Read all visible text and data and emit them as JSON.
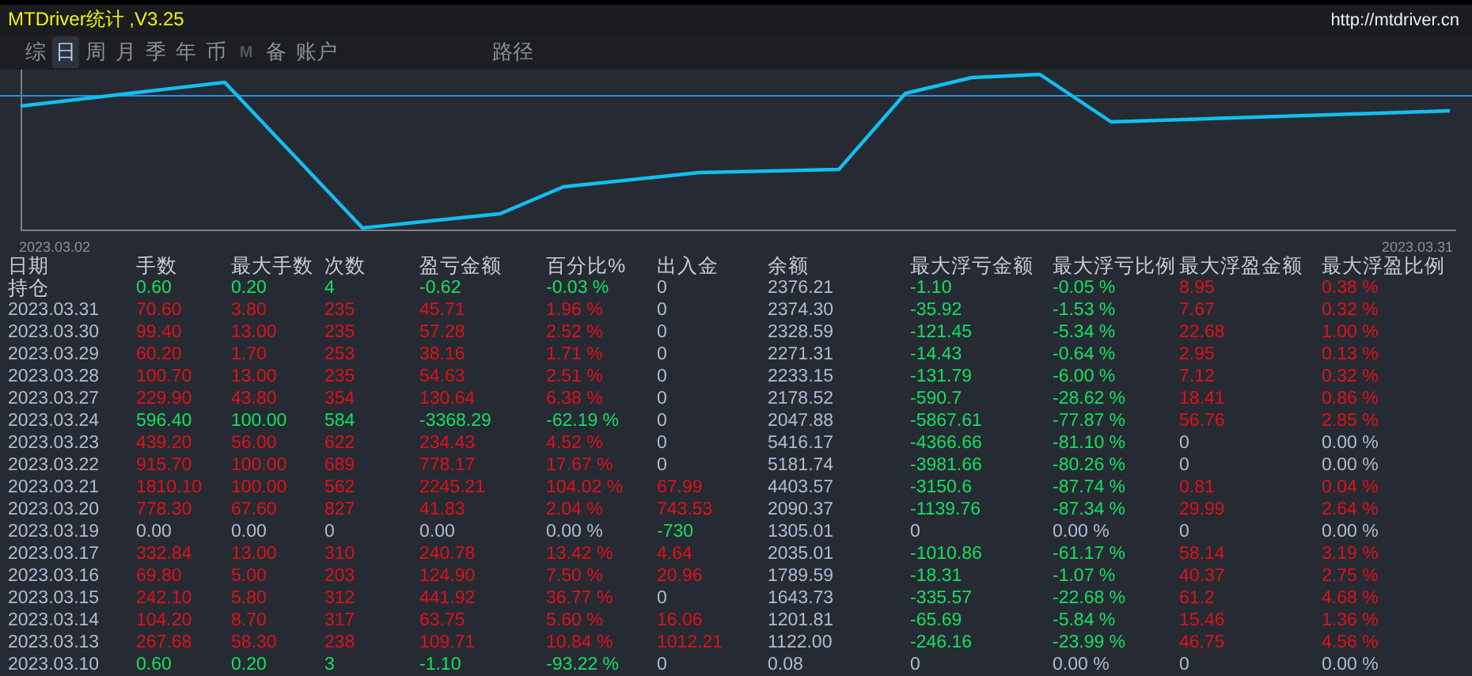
{
  "window": {
    "title": "MTDriver统计 ,V3.25",
    "link": "http://mtdriver.cn"
  },
  "tabs": [
    {
      "label": "综",
      "selected": false,
      "disabled": false
    },
    {
      "label": "日",
      "selected": true,
      "disabled": false
    },
    {
      "label": "周",
      "selected": false,
      "disabled": false
    },
    {
      "label": "月",
      "selected": false,
      "disabled": false
    },
    {
      "label": "季",
      "selected": false,
      "disabled": false
    },
    {
      "label": "年",
      "selected": false,
      "disabled": false
    },
    {
      "label": "币",
      "selected": false,
      "disabled": false
    },
    {
      "label": "M",
      "selected": false,
      "disabled": true
    },
    {
      "label": "备",
      "selected": false,
      "disabled": false
    },
    {
      "label": "账户",
      "selected": false,
      "disabled": false
    }
  ],
  "extra_tabs": [
    {
      "label": "路径",
      "selected": false,
      "disabled": false
    }
  ],
  "chart": {
    "start_label": "2023.03.02",
    "end_label": "2023.03.31"
  },
  "table": {
    "columns": [
      "日期",
      "手数",
      "最大手数",
      "次数",
      "盈亏金额",
      "百分比%",
      "出入金",
      "余额",
      "最大浮亏金额",
      "最大浮亏比例",
      "最大浮盈金额",
      "最大浮盈比例"
    ],
    "rows": [
      {
        "kind": "holding",
        "cells": [
          {
            "text": "持仓",
            "color": "#c8ccd2"
          },
          {
            "text": "0.60",
            "color": "#14e060"
          },
          {
            "text": "0.20",
            "color": "#14e060"
          },
          {
            "text": "4",
            "color": "#14e060"
          },
          {
            "text": "-0.62",
            "color": "#14e060"
          },
          {
            "text": "-0.03 %",
            "color": "#14e060"
          },
          {
            "text": "0",
            "color": "#aebbd0"
          },
          {
            "text": "2376.21",
            "color": "#aebbd0"
          },
          {
            "text": "-1.10",
            "color": "#14e060"
          },
          {
            "text": "-0.05 %",
            "color": "#14e060"
          },
          {
            "text": "8.95",
            "color": "#e01018"
          },
          {
            "text": "0.38 %",
            "color": "#e01018"
          }
        ]
      },
      {
        "kind": "day",
        "cells": [
          {
            "text": "2023.03.31",
            "color": "#aebbd0"
          },
          {
            "text": "70.60",
            "color": "#e01018"
          },
          {
            "text": "3.80",
            "color": "#e01018"
          },
          {
            "text": "235",
            "color": "#e01018"
          },
          {
            "text": "45.71",
            "color": "#e01018"
          },
          {
            "text": "1.96 %",
            "color": "#e01018"
          },
          {
            "text": "0",
            "color": "#aebbd0"
          },
          {
            "text": "2374.30",
            "color": "#aebbd0"
          },
          {
            "text": "-35.92",
            "color": "#14e060"
          },
          {
            "text": "-1.53 %",
            "color": "#14e060"
          },
          {
            "text": "7.67",
            "color": "#e01018"
          },
          {
            "text": "0.32 %",
            "color": "#e01018"
          }
        ]
      },
      {
        "kind": "day",
        "cells": [
          {
            "text": "2023.03.30",
            "color": "#aebbd0"
          },
          {
            "text": "99.40",
            "color": "#e01018"
          },
          {
            "text": "13.00",
            "color": "#e01018"
          },
          {
            "text": "235",
            "color": "#e01018"
          },
          {
            "text": "57.28",
            "color": "#e01018"
          },
          {
            "text": "2.52 %",
            "color": "#e01018"
          },
          {
            "text": "0",
            "color": "#aebbd0"
          },
          {
            "text": "2328.59",
            "color": "#aebbd0"
          },
          {
            "text": "-121.45",
            "color": "#14e060"
          },
          {
            "text": "-5.34 %",
            "color": "#14e060"
          },
          {
            "text": "22.68",
            "color": "#e01018"
          },
          {
            "text": "1.00 %",
            "color": "#e01018"
          }
        ]
      },
      {
        "kind": "day",
        "cells": [
          {
            "text": "2023.03.29",
            "color": "#aebbd0"
          },
          {
            "text": "60.20",
            "color": "#e01018"
          },
          {
            "text": "1.70",
            "color": "#e01018"
          },
          {
            "text": "253",
            "color": "#e01018"
          },
          {
            "text": "38.16",
            "color": "#e01018"
          },
          {
            "text": "1.71 %",
            "color": "#e01018"
          },
          {
            "text": "0",
            "color": "#aebbd0"
          },
          {
            "text": "2271.31",
            "color": "#aebbd0"
          },
          {
            "text": "-14.43",
            "color": "#14e060"
          },
          {
            "text": "-0.64 %",
            "color": "#14e060"
          },
          {
            "text": "2.95",
            "color": "#e01018"
          },
          {
            "text": "0.13 %",
            "color": "#e01018"
          }
        ]
      },
      {
        "kind": "day",
        "cells": [
          {
            "text": "2023.03.28",
            "color": "#aebbd0"
          },
          {
            "text": "100.70",
            "color": "#e01018"
          },
          {
            "text": "13.00",
            "color": "#e01018"
          },
          {
            "text": "235",
            "color": "#e01018"
          },
          {
            "text": "54.63",
            "color": "#e01018"
          },
          {
            "text": "2.51 %",
            "color": "#e01018"
          },
          {
            "text": "0",
            "color": "#aebbd0"
          },
          {
            "text": "2233.15",
            "color": "#aebbd0"
          },
          {
            "text": "-131.79",
            "color": "#14e060"
          },
          {
            "text": "-6.00 %",
            "color": "#14e060"
          },
          {
            "text": "7.12",
            "color": "#e01018"
          },
          {
            "text": "0.32 %",
            "color": "#e01018"
          }
        ]
      },
      {
        "kind": "day",
        "cells": [
          {
            "text": "2023.03.27",
            "color": "#aebbd0"
          },
          {
            "text": "229.90",
            "color": "#e01018"
          },
          {
            "text": "43.80",
            "color": "#e01018"
          },
          {
            "text": "354",
            "color": "#e01018"
          },
          {
            "text": "130.64",
            "color": "#e01018"
          },
          {
            "text": "6.38 %",
            "color": "#e01018"
          },
          {
            "text": "0",
            "color": "#aebbd0"
          },
          {
            "text": "2178.52",
            "color": "#aebbd0"
          },
          {
            "text": "-590.7",
            "color": "#14e060"
          },
          {
            "text": "-28.62 %",
            "color": "#14e060"
          },
          {
            "text": "18.41",
            "color": "#e01018"
          },
          {
            "text": "0.86 %",
            "color": "#e01018"
          }
        ]
      },
      {
        "kind": "day",
        "cells": [
          {
            "text": "2023.03.24",
            "color": "#aebbd0"
          },
          {
            "text": "596.40",
            "color": "#14e060"
          },
          {
            "text": "100.00",
            "color": "#14e060"
          },
          {
            "text": "584",
            "color": "#14e060"
          },
          {
            "text": "-3368.29",
            "color": "#14e060"
          },
          {
            "text": "-62.19 %",
            "color": "#14e060"
          },
          {
            "text": "0",
            "color": "#aebbd0"
          },
          {
            "text": "2047.88",
            "color": "#aebbd0"
          },
          {
            "text": "-5867.61",
            "color": "#14e060"
          },
          {
            "text": "-77.87 %",
            "color": "#14e060"
          },
          {
            "text": "56.76",
            "color": "#e01018"
          },
          {
            "text": "2.85 %",
            "color": "#e01018"
          }
        ]
      },
      {
        "kind": "day",
        "cells": [
          {
            "text": "2023.03.23",
            "color": "#aebbd0"
          },
          {
            "text": "439.20",
            "color": "#e01018"
          },
          {
            "text": "56.00",
            "color": "#e01018"
          },
          {
            "text": "622",
            "color": "#e01018"
          },
          {
            "text": "234.43",
            "color": "#e01018"
          },
          {
            "text": "4.52 %",
            "color": "#e01018"
          },
          {
            "text": "0",
            "color": "#aebbd0"
          },
          {
            "text": "5416.17",
            "color": "#aebbd0"
          },
          {
            "text": "-4366.66",
            "color": "#14e060"
          },
          {
            "text": "-81.10 %",
            "color": "#14e060"
          },
          {
            "text": "0",
            "color": "#aebbd0"
          },
          {
            "text": "0.00 %",
            "color": "#aebbd0"
          }
        ]
      },
      {
        "kind": "day",
        "cells": [
          {
            "text": "2023.03.22",
            "color": "#aebbd0"
          },
          {
            "text": "915.70",
            "color": "#e01018"
          },
          {
            "text": "100.00",
            "color": "#e01018"
          },
          {
            "text": "689",
            "color": "#e01018"
          },
          {
            "text": "778.17",
            "color": "#e01018"
          },
          {
            "text": "17.67 %",
            "color": "#e01018"
          },
          {
            "text": "0",
            "color": "#aebbd0"
          },
          {
            "text": "5181.74",
            "color": "#aebbd0"
          },
          {
            "text": "-3981.66",
            "color": "#14e060"
          },
          {
            "text": "-80.26 %",
            "color": "#14e060"
          },
          {
            "text": "0",
            "color": "#aebbd0"
          },
          {
            "text": "0.00 %",
            "color": "#aebbd0"
          }
        ]
      },
      {
        "kind": "day",
        "cells": [
          {
            "text": "2023.03.21",
            "color": "#aebbd0"
          },
          {
            "text": "1810.10",
            "color": "#e01018"
          },
          {
            "text": "100.00",
            "color": "#e01018"
          },
          {
            "text": "562",
            "color": "#e01018"
          },
          {
            "text": "2245.21",
            "color": "#e01018"
          },
          {
            "text": "104.02 %",
            "color": "#e01018"
          },
          {
            "text": "67.99",
            "color": "#e01018"
          },
          {
            "text": "4403.57",
            "color": "#aebbd0"
          },
          {
            "text": "-3150.6",
            "color": "#14e060"
          },
          {
            "text": "-87.74 %",
            "color": "#14e060"
          },
          {
            "text": "0.81",
            "color": "#e01018"
          },
          {
            "text": "0.04 %",
            "color": "#e01018"
          }
        ]
      },
      {
        "kind": "day",
        "cells": [
          {
            "text": "2023.03.20",
            "color": "#aebbd0"
          },
          {
            "text": "778.30",
            "color": "#e01018"
          },
          {
            "text": "67.60",
            "color": "#e01018"
          },
          {
            "text": "827",
            "color": "#e01018"
          },
          {
            "text": "41.83",
            "color": "#e01018"
          },
          {
            "text": "2.04 %",
            "color": "#e01018"
          },
          {
            "text": "743.53",
            "color": "#e01018"
          },
          {
            "text": "2090.37",
            "color": "#aebbd0"
          },
          {
            "text": "-1139.76",
            "color": "#14e060"
          },
          {
            "text": "-87.34 %",
            "color": "#14e060"
          },
          {
            "text": "29.99",
            "color": "#e01018"
          },
          {
            "text": "2.64 %",
            "color": "#e01018"
          }
        ]
      },
      {
        "kind": "day",
        "cells": [
          {
            "text": "2023.03.19",
            "color": "#aebbd0"
          },
          {
            "text": "0.00",
            "color": "#aebbd0"
          },
          {
            "text": "0.00",
            "color": "#aebbd0"
          },
          {
            "text": "0",
            "color": "#aebbd0"
          },
          {
            "text": "0.00",
            "color": "#aebbd0"
          },
          {
            "text": "0.00 %",
            "color": "#aebbd0"
          },
          {
            "text": "-730",
            "color": "#14e060"
          },
          {
            "text": "1305.01",
            "color": "#aebbd0"
          },
          {
            "text": "0",
            "color": "#aebbd0"
          },
          {
            "text": "0.00 %",
            "color": "#aebbd0"
          },
          {
            "text": "0",
            "color": "#aebbd0"
          },
          {
            "text": "0.00 %",
            "color": "#aebbd0"
          }
        ]
      },
      {
        "kind": "day",
        "cells": [
          {
            "text": "2023.03.17",
            "color": "#aebbd0"
          },
          {
            "text": "332.84",
            "color": "#e01018"
          },
          {
            "text": "13.00",
            "color": "#e01018"
          },
          {
            "text": "310",
            "color": "#e01018"
          },
          {
            "text": "240.78",
            "color": "#e01018"
          },
          {
            "text": "13.42 %",
            "color": "#e01018"
          },
          {
            "text": "4.64",
            "color": "#e01018"
          },
          {
            "text": "2035.01",
            "color": "#aebbd0"
          },
          {
            "text": "-1010.86",
            "color": "#14e060"
          },
          {
            "text": "-61.17 %",
            "color": "#14e060"
          },
          {
            "text": "58.14",
            "color": "#e01018"
          },
          {
            "text": "3.19 %",
            "color": "#e01018"
          }
        ]
      },
      {
        "kind": "day",
        "cells": [
          {
            "text": "2023.03.16",
            "color": "#aebbd0"
          },
          {
            "text": "69.80",
            "color": "#e01018"
          },
          {
            "text": "5.00",
            "color": "#e01018"
          },
          {
            "text": "203",
            "color": "#e01018"
          },
          {
            "text": "124.90",
            "color": "#e01018"
          },
          {
            "text": "7.50 %",
            "color": "#e01018"
          },
          {
            "text": "20.96",
            "color": "#e01018"
          },
          {
            "text": "1789.59",
            "color": "#aebbd0"
          },
          {
            "text": "-18.31",
            "color": "#14e060"
          },
          {
            "text": "-1.07 %",
            "color": "#14e060"
          },
          {
            "text": "40.37",
            "color": "#e01018"
          },
          {
            "text": "2.75 %",
            "color": "#e01018"
          }
        ]
      },
      {
        "kind": "day",
        "cells": [
          {
            "text": "2023.03.15",
            "color": "#aebbd0"
          },
          {
            "text": "242.10",
            "color": "#e01018"
          },
          {
            "text": "5.80",
            "color": "#e01018"
          },
          {
            "text": "312",
            "color": "#e01018"
          },
          {
            "text": "441.92",
            "color": "#e01018"
          },
          {
            "text": "36.77 %",
            "color": "#e01018"
          },
          {
            "text": "0",
            "color": "#aebbd0"
          },
          {
            "text": "1643.73",
            "color": "#aebbd0"
          },
          {
            "text": "-335.57",
            "color": "#14e060"
          },
          {
            "text": "-22.68 %",
            "color": "#14e060"
          },
          {
            "text": "61.2",
            "color": "#e01018"
          },
          {
            "text": "4.68 %",
            "color": "#e01018"
          }
        ]
      },
      {
        "kind": "day",
        "cells": [
          {
            "text": "2023.03.14",
            "color": "#aebbd0"
          },
          {
            "text": "104.20",
            "color": "#e01018"
          },
          {
            "text": "8.70",
            "color": "#e01018"
          },
          {
            "text": "317",
            "color": "#e01018"
          },
          {
            "text": "63.75",
            "color": "#e01018"
          },
          {
            "text": "5.60 %",
            "color": "#e01018"
          },
          {
            "text": "16.06",
            "color": "#e01018"
          },
          {
            "text": "1201.81",
            "color": "#aebbd0"
          },
          {
            "text": "-65.69",
            "color": "#14e060"
          },
          {
            "text": "-5.84 %",
            "color": "#14e060"
          },
          {
            "text": "15.46",
            "color": "#e01018"
          },
          {
            "text": "1.36 %",
            "color": "#e01018"
          }
        ]
      },
      {
        "kind": "day",
        "cells": [
          {
            "text": "2023.03.13",
            "color": "#aebbd0"
          },
          {
            "text": "267.68",
            "color": "#e01018"
          },
          {
            "text": "58.30",
            "color": "#e01018"
          },
          {
            "text": "238",
            "color": "#e01018"
          },
          {
            "text": "109.71",
            "color": "#e01018"
          },
          {
            "text": "10.84 %",
            "color": "#e01018"
          },
          {
            "text": "1012.21",
            "color": "#e01018"
          },
          {
            "text": "1122.00",
            "color": "#aebbd0"
          },
          {
            "text": "-246.16",
            "color": "#14e060"
          },
          {
            "text": "-23.99 %",
            "color": "#14e060"
          },
          {
            "text": "46.75",
            "color": "#e01018"
          },
          {
            "text": "4.56 %",
            "color": "#e01018"
          }
        ]
      },
      {
        "kind": "day",
        "cells": [
          {
            "text": "2023.03.10",
            "color": "#aebbd0"
          },
          {
            "text": "0.60",
            "color": "#14e060"
          },
          {
            "text": "0.20",
            "color": "#14e060"
          },
          {
            "text": "3",
            "color": "#14e060"
          },
          {
            "text": "-1.10",
            "color": "#14e060"
          },
          {
            "text": "-93.22 %",
            "color": "#14e060"
          },
          {
            "text": "0",
            "color": "#aebbd0"
          },
          {
            "text": "0.08",
            "color": "#aebbd0"
          },
          {
            "text": "0",
            "color": "#aebbd0"
          },
          {
            "text": "0.00 %",
            "color": "#aebbd0"
          },
          {
            "text": "0",
            "color": "#aebbd0"
          },
          {
            "text": "0.00 %",
            "color": "#aebbd0"
          }
        ]
      }
    ]
  }
}
